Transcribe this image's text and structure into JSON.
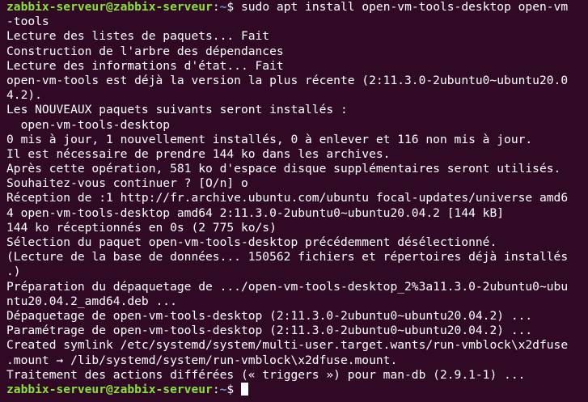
{
  "prompt": {
    "user_host": "zabbix-serveur@zabbix-serveur",
    "separator": ":",
    "path": "~",
    "symbol": "$ "
  },
  "command": {
    "line1": "sudo apt install open-vm-tools-desktop open-vm",
    "line2": "-tools"
  },
  "output": [
    "Lecture des listes de paquets... Fait",
    "Construction de l'arbre des dépendances",
    "Lecture des informations d'état... Fait",
    "open-vm-tools est déjà la version la plus récente (2:11.3.0-2ubuntu0~ubuntu20.0",
    "4.2).",
    "Les NOUVEAUX paquets suivants seront installés :",
    "  open-vm-tools-desktop",
    "0 mis à jour, 1 nouvellement installés, 0 à enlever et 116 non mis à jour.",
    "Il est nécessaire de prendre 144 ko dans les archives.",
    "Après cette opération, 581 ko d'espace disque supplémentaires seront utilisés.",
    "Souhaitez-vous continuer ? [O/n] o",
    "Réception de :1 http://fr.archive.ubuntu.com/ubuntu focal-updates/universe amd6",
    "4 open-vm-tools-desktop amd64 2:11.3.0-2ubuntu0~ubuntu20.04.2 [144 kB]",
    "144 ko réceptionnés en 0s (2 775 ko/s)",
    "Sélection du paquet open-vm-tools-desktop précédemment désélectionné.",
    "(Lecture de la base de données... 150562 fichiers et répertoires déjà installés",
    ".)",
    "Préparation du dépaquetage de .../open-vm-tools-desktop_2%3a11.3.0-2ubuntu0~ubu",
    "ntu20.04.2_amd64.deb ...",
    "Dépaquetage de open-vm-tools-desktop (2:11.3.0-2ubuntu0~ubuntu20.04.2) ...",
    "Paramétrage de open-vm-tools-desktop (2:11.3.0-2ubuntu0~ubuntu20.04.2) ...",
    "Created symlink /etc/systemd/system/multi-user.target.wants/run-vmblock\\x2dfuse",
    ".mount → /lib/systemd/system/run-vmblock\\x2dfuse.mount.",
    "Traitement des actions différées (« triggers ») pour man-db (2.9.1-1) ..."
  ],
  "colors": {
    "background": "#300a24",
    "text": "#ffffff",
    "prompt_user": "#8ae234",
    "prompt_path": "#729fcf"
  }
}
